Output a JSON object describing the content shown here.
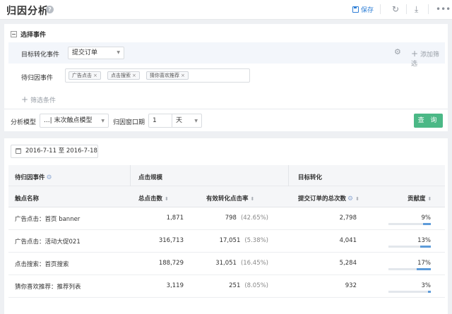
{
  "header": {
    "title": "归因分析",
    "help_icon": "help-icon",
    "save_label": "保存",
    "icons": [
      "save-icon",
      "refresh-icon",
      "download-icon",
      "more-icon"
    ]
  },
  "events": {
    "section_title": "选择事件",
    "target_label": "目标转化事件",
    "target_value": "提交订单",
    "add_filter_label": "添加筛选",
    "pending_label": "待归因事件",
    "tags": [
      "广告点击",
      "点击搜索",
      "猜你喜欢推荐"
    ],
    "add_condition_label": "筛选条件"
  },
  "model": {
    "label": "分析模型",
    "value": "...| 末次触点模型",
    "window_label": "归因窗口期",
    "window_value": "1",
    "window_unit": "天",
    "query_label": "查 询"
  },
  "date_range": "2016-7-11 至 2016-7-18",
  "table": {
    "groups": [
      "待归因事件",
      "点击规模",
      "目标转化"
    ],
    "columns": [
      "触点名称",
      "总点击数",
      "有效转化点击率",
      "提交订单的总次数",
      "贡献度"
    ],
    "rows": [
      {
        "name": "广告点击：首页 banner",
        "clicks": "1,871",
        "valid": "798",
        "rate": "(42.65%)",
        "orders": "2,798",
        "contribution": "9%",
        "contribution_value": 0.09
      },
      {
        "name": "广告点击：活动大促021",
        "clicks": "316,713",
        "valid": "17,051",
        "rate": "(5.38%)",
        "orders": "4,041",
        "contribution": "13%",
        "contribution_value": 0.13
      },
      {
        "name": "点击搜索：首页搜索",
        "clicks": "188,729",
        "valid": "31,051",
        "rate": "(16.45%)",
        "orders": "5,284",
        "contribution": "17%",
        "contribution_value": 0.17
      },
      {
        "name": "猜你喜欢推荐：推荐列表",
        "clicks": "3,119",
        "valid": "251",
        "rate": "(8.05%)",
        "orders": "932",
        "contribution": "3%",
        "contribution_value": 0.03
      }
    ]
  },
  "colors": {
    "accent": "#2f7fd6",
    "query_button": "#4bb886",
    "bar": "#5d9bd9"
  }
}
